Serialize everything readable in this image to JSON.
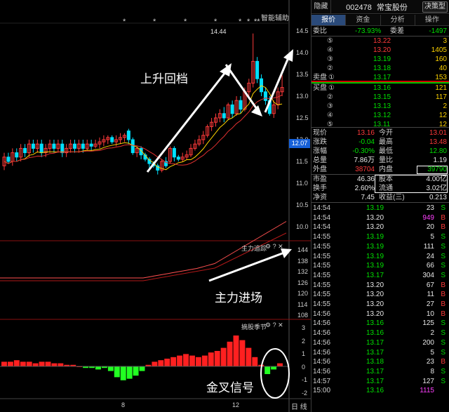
{
  "chart_header": {
    "hide_label": "隐藏",
    "smart_assist": "智能辅助",
    "stars": [
      "*",
      "*",
      "*",
      "*",
      "*",
      "*",
      "**"
    ],
    "high_label": "14.44"
  },
  "price_axis": [
    "14.5",
    "14.0",
    "13.5",
    "13.0",
    "12.5",
    "12.0",
    "11.5",
    "11.0",
    "10.5",
    "10.0"
  ],
  "price_tag": "12.07",
  "indicator1": {
    "name": "主力追踪",
    "axis": [
      "144",
      "138",
      "132",
      "126",
      "120",
      "114",
      "108"
    ]
  },
  "indicator2": {
    "name": "摘股季节",
    "axis": [
      "3",
      "2",
      "1",
      "0",
      "-1",
      "-2"
    ]
  },
  "date_axis": [
    "8",
    "12"
  ],
  "bottom_tab": "日 线",
  "annotations": {
    "rise_pullback": "上升回档",
    "main_entry": "主力进场",
    "golden_cross": "金叉信号"
  },
  "stock": {
    "code": "002478",
    "name": "常宝股份",
    "decide_btn": "决策型"
  },
  "tabs": [
    "报价",
    "资金",
    "分析",
    "操作"
  ],
  "ratio": {
    "label1": "委比",
    "value1": "-73.93%",
    "label2": "委差",
    "value2": "-1497"
  },
  "sell_ladder": [
    {
      "circ": "⑤",
      "price": "13.22",
      "vol": "3"
    },
    {
      "circ": "④",
      "price": "13.20",
      "vol": "1405"
    },
    {
      "circ": "③",
      "price": "13.19",
      "vol": "160"
    },
    {
      "circ": "②",
      "price": "13.18",
      "vol": "40"
    },
    {
      "circ": "①",
      "price": "13.17",
      "vol": "153",
      "label": "卖盘"
    }
  ],
  "buy_ladder": [
    {
      "circ": "①",
      "price": "13.16",
      "vol": "121",
      "label": "买盘"
    },
    {
      "circ": "②",
      "price": "13.15",
      "vol": "117"
    },
    {
      "circ": "③",
      "price": "13.13",
      "vol": "2"
    },
    {
      "circ": "④",
      "price": "13.12",
      "vol": "12"
    },
    {
      "circ": "⑤",
      "price": "13.11",
      "vol": "12"
    }
  ],
  "quote_stats": [
    {
      "l1": "现价",
      "v1": "13.16",
      "l2": "今开",
      "v2": "13.01",
      "c1": "red",
      "c2": "red"
    },
    {
      "l1": "涨跌",
      "v1": "-0.04",
      "l2": "最高",
      "v2": "13.48",
      "c1": "green",
      "c2": "red"
    },
    {
      "l1": "涨幅",
      "v1": "-0.30%",
      "l2": "最低",
      "v2": "12.80",
      "c1": "green",
      "c2": "green"
    },
    {
      "l1": "总量",
      "v1": "7.86万",
      "l2": "量比",
      "v2": "1.19",
      "c1": "white",
      "c2": "white"
    },
    {
      "l1": "外盘",
      "v1": "38704",
      "l2": "内盘",
      "v2": "39790",
      "c1": "red",
      "c2": "green"
    }
  ],
  "capital_stats": [
    {
      "l1": "市盈",
      "v1": "46.36",
      "l2": "股本",
      "v2": "4.00亿"
    },
    {
      "l1": "换手",
      "v1": "2.60%",
      "l2": "流通",
      "v2": "3.02亿"
    },
    {
      "l1": "净资",
      "v1": "7.45",
      "l2": "收益(三)",
      "v2": "0.213"
    }
  ],
  "trades": [
    {
      "time": "14:54",
      "price": "13.19",
      "vol": "23",
      "side": "S",
      "pc": "green",
      "vc": "white"
    },
    {
      "time": "14:54",
      "price": "13.20",
      "vol": "949",
      "side": "B",
      "pc": "white",
      "vc": "magenta"
    },
    {
      "time": "14:54",
      "price": "13.20",
      "vol": "20",
      "side": "B",
      "pc": "white",
      "vc": "white"
    },
    {
      "time": "14:55",
      "price": "13.19",
      "vol": "5",
      "side": "S",
      "pc": "green",
      "vc": "white"
    },
    {
      "time": "14:55",
      "price": "13.19",
      "vol": "111",
      "side": "S",
      "pc": "green",
      "vc": "white"
    },
    {
      "time": "14:55",
      "price": "13.19",
      "vol": "24",
      "side": "S",
      "pc": "green",
      "vc": "white"
    },
    {
      "time": "14:55",
      "price": "13.19",
      "vol": "66",
      "side": "S",
      "pc": "green",
      "vc": "white"
    },
    {
      "time": "14:55",
      "price": "13.17",
      "vol": "304",
      "side": "S",
      "pc": "green",
      "vc": "white"
    },
    {
      "time": "14:55",
      "price": "13.20",
      "vol": "67",
      "side": "B",
      "pc": "white",
      "vc": "white"
    },
    {
      "time": "14:55",
      "price": "13.20",
      "vol": "11",
      "side": "B",
      "pc": "white",
      "vc": "white"
    },
    {
      "time": "14:55",
      "price": "13.20",
      "vol": "27",
      "side": "B",
      "pc": "white",
      "vc": "white"
    },
    {
      "time": "14:56",
      "price": "13.20",
      "vol": "10",
      "side": "B",
      "pc": "white",
      "vc": "white"
    },
    {
      "time": "14:56",
      "price": "13.16",
      "vol": "125",
      "side": "S",
      "pc": "green",
      "vc": "white"
    },
    {
      "time": "14:56",
      "price": "13.16",
      "vol": "2",
      "side": "S",
      "pc": "green",
      "vc": "white"
    },
    {
      "time": "14:56",
      "price": "13.17",
      "vol": "200",
      "side": "S",
      "pc": "green",
      "vc": "white"
    },
    {
      "time": "14:56",
      "price": "13.17",
      "vol": "5",
      "side": "S",
      "pc": "green",
      "vc": "white"
    },
    {
      "time": "14:56",
      "price": "13.18",
      "vol": "23",
      "side": "B",
      "pc": "green",
      "vc": "white"
    },
    {
      "time": "14:56",
      "price": "13.17",
      "vol": "8",
      "side": "S",
      "pc": "green",
      "vc": "white"
    },
    {
      "time": "14:57",
      "price": "13.17",
      "vol": "127",
      "side": "S",
      "pc": "green",
      "vc": "white"
    },
    {
      "time": "15:00",
      "price": "13.16",
      "vol": "1115",
      "side": "",
      "pc": "green",
      "vc": "magenta"
    }
  ],
  "colors": {
    "up": "#ff3a3a",
    "down": "#00e0ff",
    "ma_fast": "#ffd400",
    "ma_slow": "#e03030",
    "macd_pos": "#ff2020",
    "macd_neg": "#22ff22"
  }
}
